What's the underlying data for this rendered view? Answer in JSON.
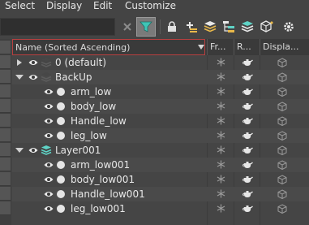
{
  "menu": {
    "items": [
      "Select",
      "Display",
      "Edit",
      "Customize"
    ]
  },
  "columns": {
    "name": "Name (Sorted Ascending)",
    "frozen": "Fr...",
    "render": "R...",
    "display": "Displa..."
  },
  "tree": [
    {
      "label": "0 (default)",
      "kind": "layer",
      "expanded": false
    },
    {
      "label": "BackUp",
      "kind": "layer",
      "expanded": true
    },
    {
      "label": "arm_low",
      "kind": "object"
    },
    {
      "label": "body_low",
      "kind": "object"
    },
    {
      "label": "Handle_low",
      "kind": "object"
    },
    {
      "label": "leg_low",
      "kind": "object"
    },
    {
      "label": "Layer001",
      "kind": "layer-active",
      "expanded": true
    },
    {
      "label": "arm_low001",
      "kind": "object"
    },
    {
      "label": "body_low001",
      "kind": "object"
    },
    {
      "label": "Handle_low001",
      "kind": "object"
    },
    {
      "label": "leg_low001",
      "kind": "object"
    }
  ],
  "colors": {
    "filter_active": "#7a7a7a",
    "sort_header_border": "#b84040",
    "active_layer_icon": "#5fd3c6"
  }
}
